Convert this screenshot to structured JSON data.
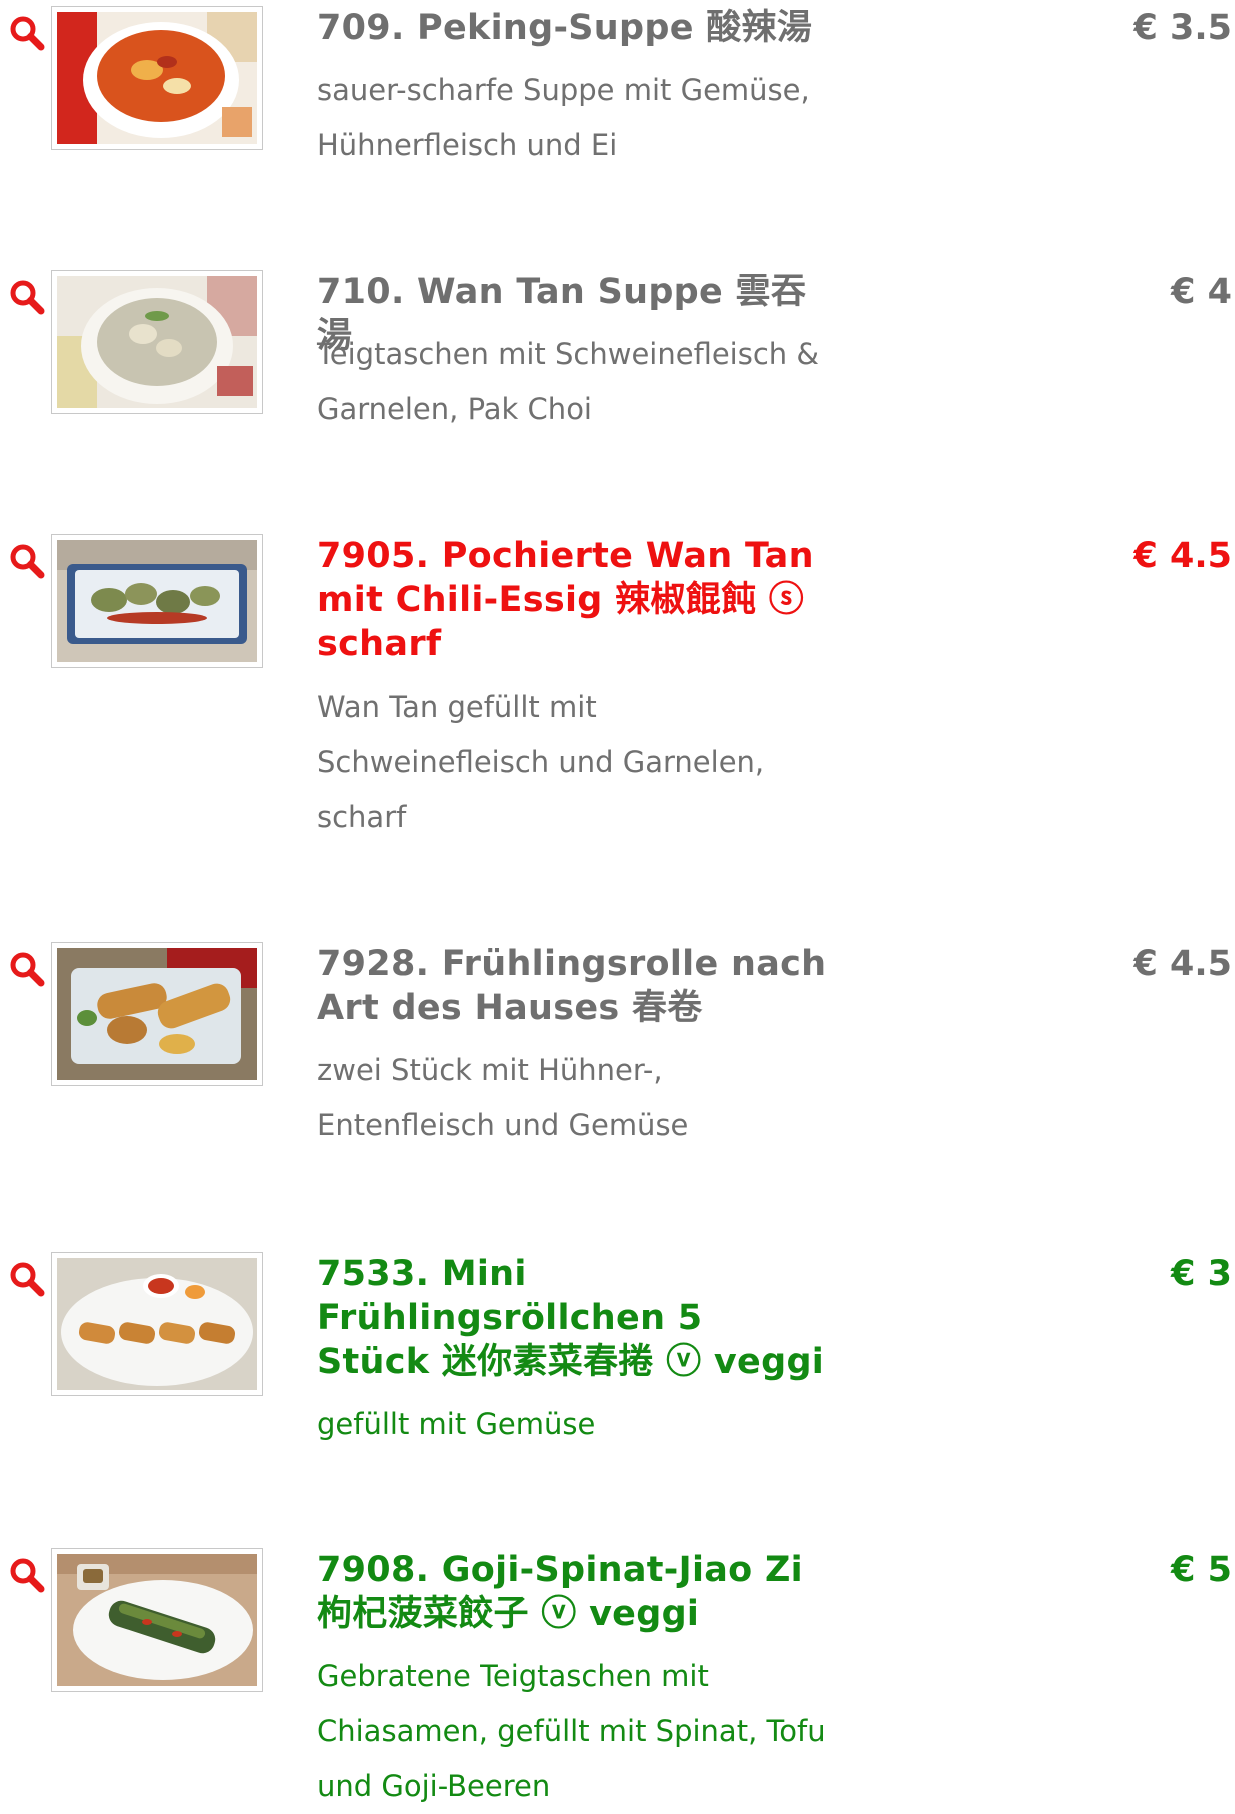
{
  "colors": {
    "default_text": "#6f6f6f",
    "spicy": "#ee1111",
    "veggi": "#138a13",
    "zoom_icon": "#e61a1a"
  },
  "icons": {
    "zoom": "magnifier-icon"
  },
  "items": [
    {
      "title": "709. Peking-Suppe 酸辣湯",
      "description": "sauer-scharfe Suppe mit Gemüse, Hühnerfleisch und Ei",
      "price": "€ 3.5",
      "image_alt": "red hot and sour soup in a white bowl"
    },
    {
      "title": "710. Wan Tan Suppe 雲吞湯",
      "description": "Teigtaschen mit Schweinefleisch & Garnelen, Pak Choi",
      "price": "€ 4",
      "image_alt": "clear soup with wonton dumplings"
    },
    {
      "title": "7905. Pochierte Wan Tan mit Chili-Essig 辣椒餛飩 ⓢ scharf",
      "description": "Wan Tan gefüllt mit Schweinefleisch und Garnelen, scharf",
      "price": "€ 4.5",
      "image_alt": "poached wontons on a blue plate"
    },
    {
      "title": "7928. Frühlingsrolle nach Art des Hauses 春卷",
      "description": "zwei Stück mit Hühner-, Entenfleisch und Gemüse",
      "price": "€ 4.5",
      "image_alt": "spring rolls on a plate"
    },
    {
      "title": "7533. Mini Frühlingsröllchen 5 Stück 迷你素菜春捲 ⓥ veggi",
      "description": "gefüllt mit Gemüse",
      "price": "€ 3",
      "image_alt": "mini spring rolls with dipping sauce"
    },
    {
      "title": "7908. Goji-Spinat-Jiao Zi 枸杞菠菜餃子 ⓥ veggi",
      "description": "Gebratene Teigtaschen mit Chiasamen, gefüllt mit Spinat, Tofu und Goji-Beeren",
      "price": "€ 5",
      "image_alt": "fried green dumplings on a white plate"
    }
  ]
}
